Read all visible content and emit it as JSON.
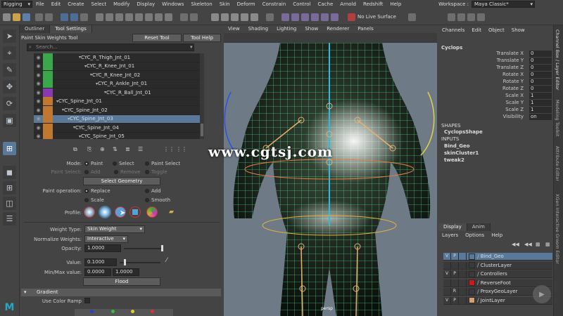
{
  "menubar": {
    "mode": "Rigging",
    "items": [
      "File",
      "Edit",
      "Create",
      "Select",
      "Modify",
      "Display",
      "Windows",
      "Skeleton",
      "Skin",
      "Deform",
      "Constrain",
      "Control",
      "Cache",
      "Arnold",
      "Redshift",
      "Help"
    ],
    "workspace_label": "Workspace :",
    "workspace_value": "Maya Classic*"
  },
  "toolbar": {
    "live_surface": "No Live Surface"
  },
  "left_panel": {
    "tabs": [
      "Outliner",
      "Tool Settings"
    ],
    "tool_name": "Paint Skin Weights Tool",
    "reset_button": "Reset Tool",
    "help_button": "Tool Help",
    "search_placeholder": "Search...",
    "joints": [
      {
        "name": "CYC_R_Thigh_Jnt_01",
        "color": "#3aa84a",
        "indent": 36
      },
      {
        "name": "CYC_R_Knee_Jnt_01",
        "color": "#3aa84a",
        "indent": 44
      },
      {
        "name": "CYC_R_Knee_Jnt_02",
        "color": "#3aa84a",
        "indent": 52
      },
      {
        "name": "CYC_R_Ankle_Jnt_01",
        "color": "#3aa84a",
        "indent": 60
      },
      {
        "name": "CYC_R_Ball_Jnt_01",
        "color": "#8a3ab0",
        "indent": 72
      },
      {
        "name": "CYC_Spine_Jnt_01",
        "color": "#c07830",
        "indent": 4
      },
      {
        "name": "CYC_Spine_Jnt_02",
        "color": "#c07830",
        "indent": 12
      },
      {
        "name": "CYC_Spine_Jnt_03",
        "color": "#c07830",
        "indent": 20,
        "selected": true
      },
      {
        "name": "CYC_Spine_Jnt_04",
        "color": "#c07830",
        "indent": 28
      },
      {
        "name": "CYC_Spine_Jnt_05",
        "color": "#c07830",
        "indent": 36
      }
    ],
    "mode_label": "Mode:",
    "mode_options": [
      "Paint",
      "Select",
      "Paint Select"
    ],
    "paint_select_label": "Paint Select:",
    "paint_select_options": [
      "Add",
      "Remove",
      "Toggle"
    ],
    "select_geometry_button": "Select Geometry",
    "paint_op_label": "Paint operation:",
    "paint_op_options": [
      "Replace",
      "Add",
      "Scale",
      "Smooth"
    ],
    "profile_label": "Profile:",
    "weight_type_label": "Weight Type:",
    "weight_type_value": "Skin Weight",
    "normalize_label": "Normalize Weights:",
    "normalize_value": "Interactive",
    "opacity_label": "Opacity:",
    "opacity_value": "1.0000",
    "opacity_level": 1.0,
    "value_label": "Value:",
    "value_value": "0.1000",
    "value_level": 0.1,
    "minmax_label": "Min/Max value:",
    "min_value": "0.0000",
    "max_value": "1.0000",
    "flood_button": "Flood",
    "gradient_header": "Gradient",
    "use_color_ramp_label": "Use Color Ramp"
  },
  "viewport": {
    "menu": [
      "View",
      "Shading",
      "Lighting",
      "Show",
      "Renderer",
      "Panels"
    ],
    "camera_label": "persp"
  },
  "watermark": "www.cgtsj.com",
  "channel_box": {
    "menu": [
      "Channels",
      "Edit",
      "Object",
      "Show"
    ],
    "object_name": "Cyclops",
    "attributes": [
      {
        "label": "Translate X",
        "value": "0"
      },
      {
        "label": "Translate Y",
        "value": "0"
      },
      {
        "label": "Translate Z",
        "value": "0"
      },
      {
        "label": "Rotate X",
        "value": "0"
      },
      {
        "label": "Rotate Y",
        "value": "0"
      },
      {
        "label": "Rotate Z",
        "value": "0"
      },
      {
        "label": "Scale X",
        "value": "1"
      },
      {
        "label": "Scale Y",
        "value": "1"
      },
      {
        "label": "Scale Z",
        "value": "1"
      },
      {
        "label": "Visibility",
        "value": "on"
      }
    ],
    "shapes_header": "SHAPES",
    "shape_name": "CyclopsShape",
    "inputs_header": "INPUTS",
    "inputs": [
      "Bind_Geo",
      "skinCluster1",
      "tweak2"
    ]
  },
  "layer_editor": {
    "tabs": [
      "Display",
      "Anim"
    ],
    "menu": [
      "Layers",
      "Options",
      "Help"
    ],
    "layers": [
      {
        "v": "V",
        "p": "P",
        "name": "Bind_Geo",
        "color": "",
        "selected": true
      },
      {
        "v": "",
        "p": "",
        "name": "ClusterLayer",
        "color": ""
      },
      {
        "v": "V",
        "p": "P",
        "name": "Controllers",
        "color": ""
      },
      {
        "v": "",
        "p": "",
        "name": "ReverseFoot",
        "color": "#d01818"
      },
      {
        "v": "",
        "p": "R",
        "name": "ProxyGeoLayer",
        "color": ""
      },
      {
        "v": "V",
        "p": "P",
        "name": "JointLayer",
        "color": "#d8a070"
      }
    ]
  },
  "right_strip": {
    "tabs": [
      "Channel Box / Layer Editor",
      "Modeling Toolkit",
      "Attribute Editor",
      "XGen Interactive Groom Editor"
    ]
  },
  "colors": {
    "selection": "#5a7898",
    "accent_teal": "#25a7c0"
  }
}
